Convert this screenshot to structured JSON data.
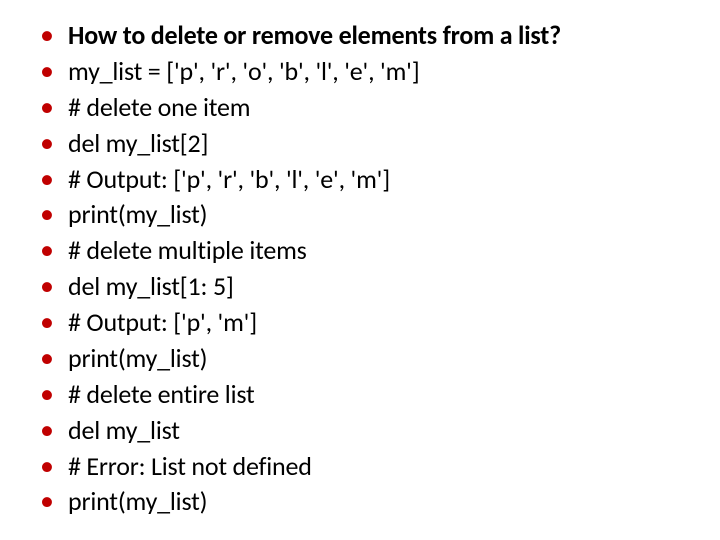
{
  "slide": {
    "items": [
      {
        "text": "How to delete or remove elements from a list?",
        "bold": true
      },
      {
        "text": "my_list = ['p', 'r', 'o', 'b', 'l', 'e', 'm']",
        "bold": false
      },
      {
        "text": "# delete one item",
        "bold": false
      },
      {
        "text": "del my_list[2]",
        "bold": false
      },
      {
        "text": "# Output: ['p', 'r', 'b', 'l', 'e', 'm']",
        "bold": false
      },
      {
        "text": "print(my_list)",
        "bold": false
      },
      {
        "text": "# delete multiple items",
        "bold": false
      },
      {
        "text": "del my_list[1: 5]",
        "bold": false
      },
      {
        "text": "# Output: ['p', 'm']",
        "bold": false
      },
      {
        "text": "print(my_list)",
        "bold": false
      },
      {
        "text": "# delete entire list",
        "bold": false
      },
      {
        "text": "del my_list",
        "bold": false
      },
      {
        "text": "# Error: List not defined",
        "bold": false
      },
      {
        "text": "print(my_list)",
        "bold": false
      }
    ]
  }
}
